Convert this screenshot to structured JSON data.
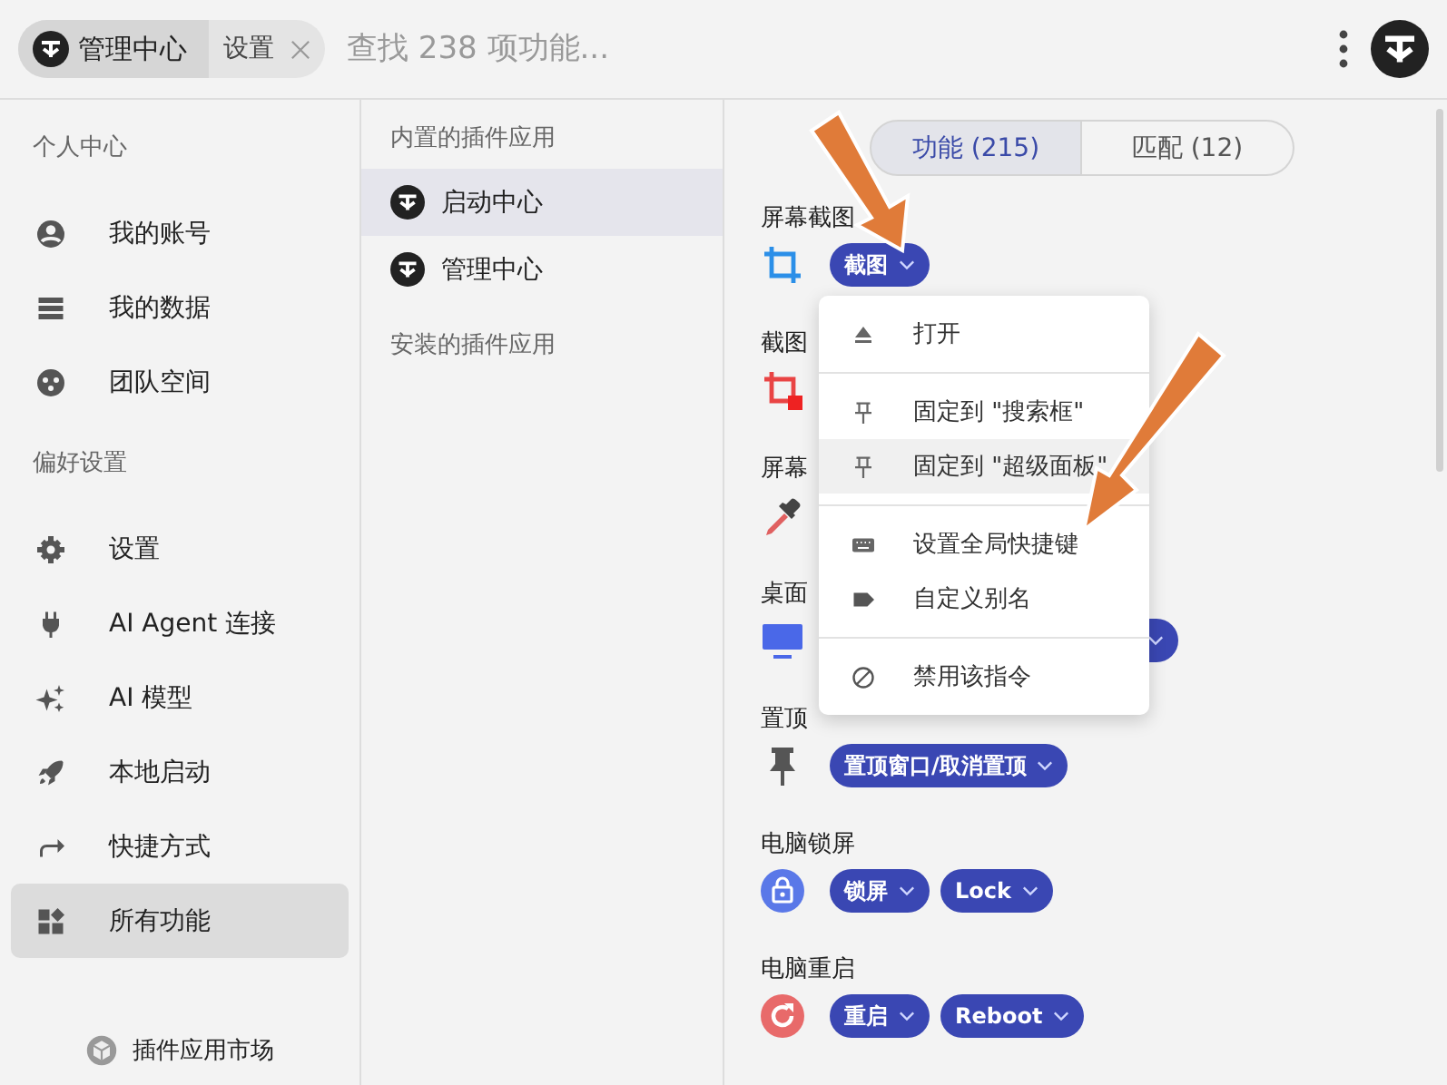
{
  "header": {
    "breadcrumbs": [
      {
        "label": "管理中心",
        "kind": "app"
      },
      {
        "label": "设置",
        "kind": "page"
      }
    ],
    "search": {
      "placeholder": "查找 238 项功能..."
    }
  },
  "sidebar": {
    "sections": [
      {
        "heading": "个人中心",
        "items": [
          {
            "label": "我的账号",
            "selected": false
          },
          {
            "label": "我的数据",
            "selected": false
          },
          {
            "label": "团队空间",
            "selected": false
          }
        ]
      },
      {
        "heading": "偏好设置",
        "items": [
          {
            "label": "设置",
            "selected": false
          },
          {
            "label": "AI Agent 连接",
            "selected": false
          },
          {
            "label": "AI 模型",
            "selected": false
          },
          {
            "label": "本地启动",
            "selected": false
          },
          {
            "label": "快捷方式",
            "selected": false
          },
          {
            "label": "所有功能",
            "selected": true
          }
        ]
      }
    ],
    "footer_link": "插件应用市场"
  },
  "plugins": {
    "sections": [
      {
        "heading": "内置的插件应用",
        "items": [
          {
            "label": "启动中心",
            "selected": true
          },
          {
            "label": "管理中心",
            "selected": false
          }
        ]
      },
      {
        "heading": "安装的插件应用"
      }
    ]
  },
  "features": {
    "tabs": [
      {
        "label": "功能 (215)",
        "selected": true
      },
      {
        "label": "匹配 (12)",
        "selected": false
      }
    ],
    "rows": [
      {
        "title": "屏幕截图",
        "chips": [
          "截图"
        ]
      },
      {
        "title": "截图"
      },
      {
        "title": "屏幕"
      },
      {
        "title": "桌面",
        "covered_chip": true
      },
      {
        "title": "置顶",
        "chips": [
          "置顶窗口/取消置顶"
        ]
      },
      {
        "title": "电脑锁屏",
        "chips": [
          "锁屏",
          "Lock"
        ]
      },
      {
        "title": "电脑重启",
        "chips": [
          "重启",
          "Reboot"
        ]
      }
    ]
  },
  "context_menu": {
    "groups": [
      [
        {
          "label": "打开",
          "selected": false
        }
      ],
      [
        {
          "label": "固定到 \"搜索框\"",
          "selected": false
        },
        {
          "label": "固定到 \"超级面板\"",
          "selected": true
        }
      ],
      [
        {
          "label": "设置全局快捷键",
          "selected": false
        },
        {
          "label": "自定义别名",
          "selected": false
        }
      ],
      [
        {
          "label": "禁用该指令",
          "selected": false
        }
      ]
    ]
  }
}
